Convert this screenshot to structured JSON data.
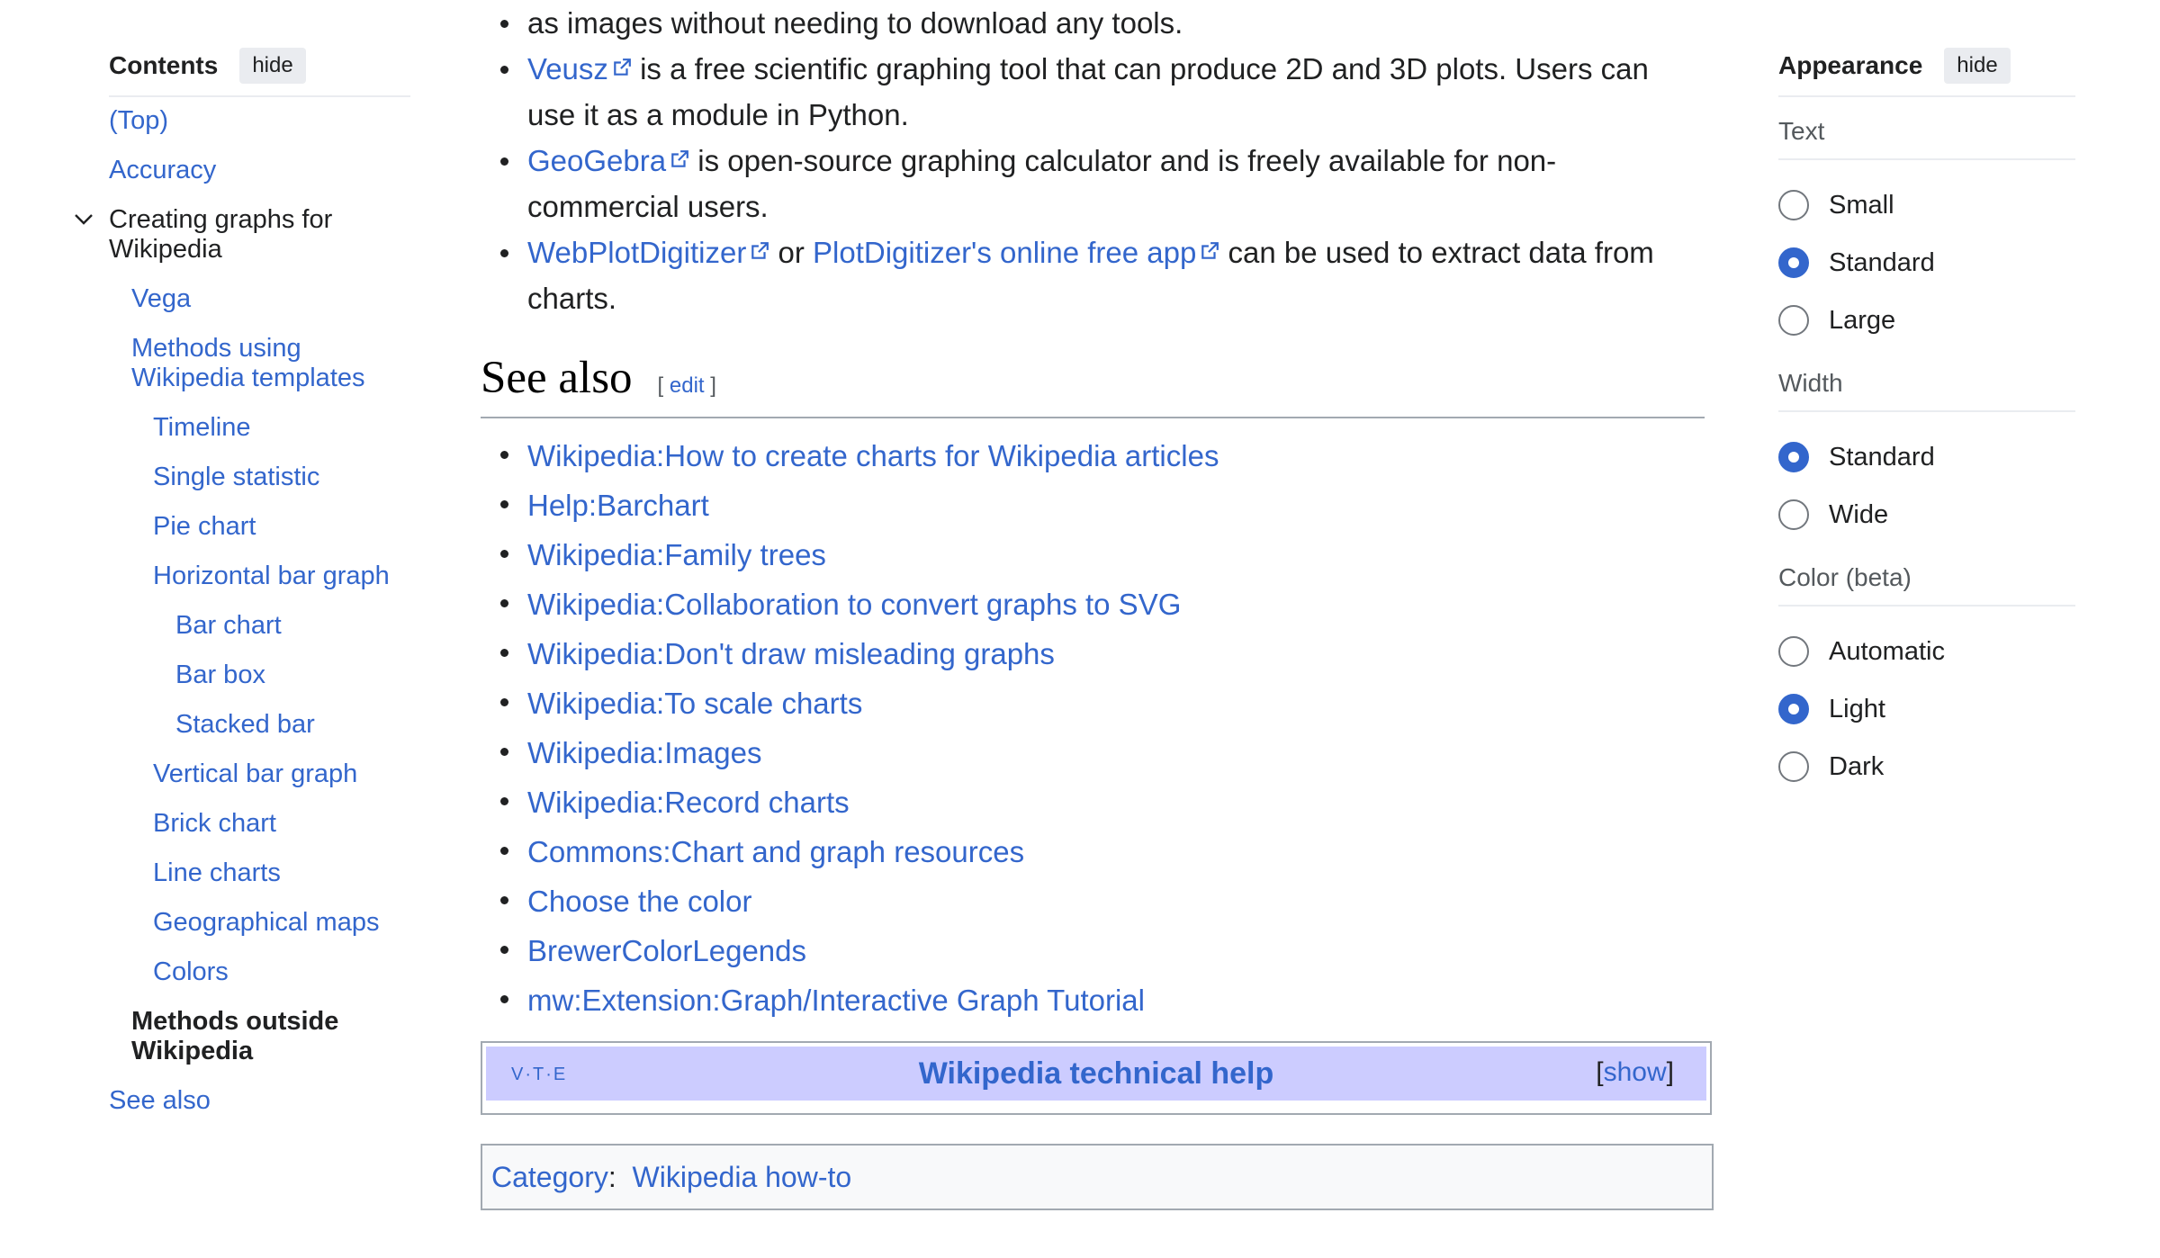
{
  "toc": {
    "title": "Contents",
    "hide_label": "hide",
    "items": [
      {
        "label": "(Top)",
        "level": 1
      },
      {
        "label": "Accuracy",
        "level": 1
      },
      {
        "label": "Creating graphs for Wikipedia",
        "level": 1
      },
      {
        "label": "Vega",
        "level": 2
      },
      {
        "label": "Methods using Wikipedia templates",
        "level": 2
      },
      {
        "label": "Timeline",
        "level": 3
      },
      {
        "label": "Single statistic",
        "level": 3
      },
      {
        "label": "Pie chart",
        "level": 3
      },
      {
        "label": "Horizontal bar graph",
        "level": 3
      },
      {
        "label": "Bar chart",
        "level": 4
      },
      {
        "label": "Bar box",
        "level": 4
      },
      {
        "label": "Stacked bar",
        "level": 4
      },
      {
        "label": "Vertical bar graph",
        "level": 3
      },
      {
        "label": "Brick chart",
        "level": 3
      },
      {
        "label": "Line charts",
        "level": 3
      },
      {
        "label": "Geographical maps",
        "level": 3
      },
      {
        "label": "Colors",
        "level": 3
      },
      {
        "label": "Methods outside Wikipedia",
        "level": 2
      },
      {
        "label": "See also",
        "level": 1
      }
    ]
  },
  "tools_list": {
    "first_tail": "as images without needing to download any tools.",
    "veusz": {
      "link": "Veusz",
      "text": " is a free scientific graphing tool that can produce 2D and 3D plots. Users can use it as a module in Python."
    },
    "geogebra": {
      "link": "GeoGebra",
      "text": " is open-source graphing calculator and is freely available for non-commercial users."
    },
    "plotdigitizer": {
      "link": "WebPlotDigitizer",
      "mid": " or ",
      "link2": "PlotDigitizer's online free app",
      "text": " can be used to extract data from charts."
    }
  },
  "see_also": {
    "heading": "See also",
    "edit_open": "[ ",
    "edit_label": "edit",
    "edit_close": " ]",
    "links": [
      "Wikipedia:How to create charts for Wikipedia articles",
      "Help:Barchart",
      "Wikipedia:Family trees",
      "Wikipedia:Collaboration to convert graphs to SVG",
      "Wikipedia:Don't draw misleading graphs",
      "Wikipedia:To scale charts",
      "Wikipedia:Images",
      "Wikipedia:Record charts",
      "Commons:Chart and graph resources",
      "Choose the color",
      "BrewerColorLegends",
      "mw:Extension:Graph/Interactive Graph Tutorial"
    ]
  },
  "navbox": {
    "vte": "V·T·E",
    "title": "Wikipedia technical help",
    "show_open": "[",
    "show_label": "show",
    "show_close": "]"
  },
  "category": {
    "label": "Category",
    "sep": ": ",
    "value": "Wikipedia how-to"
  },
  "appearance": {
    "title": "Appearance",
    "hide_label": "hide",
    "text_group": {
      "title": "Text",
      "options": [
        "Small",
        "Standard",
        "Large"
      ],
      "selected": "Standard"
    },
    "width_group": {
      "title": "Width",
      "options": [
        "Standard",
        "Wide"
      ],
      "selected": "Standard"
    },
    "color_group": {
      "title": "Color (beta)",
      "options": [
        "Automatic",
        "Light",
        "Dark"
      ],
      "selected": "Light"
    }
  },
  "colors": {
    "link": "#3366cc",
    "accent": "#3366cc",
    "navbox_bg": "#ccccff"
  }
}
